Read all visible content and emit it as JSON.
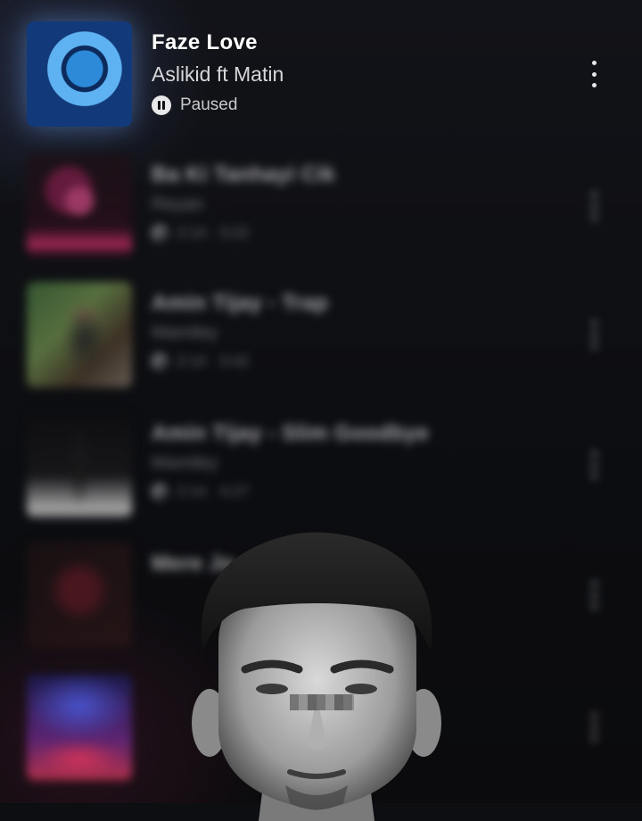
{
  "now_playing": {
    "title": "Faze Love",
    "artist": "Aslikid ft Matin",
    "status": "Paused",
    "icons": {
      "status": "pause-circle-icon",
      "menu": "more-vertical-icon"
    }
  },
  "playlist_blurred": [
    {
      "title": "Ba Ki Tanhayi Cik",
      "artist": "Reyan",
      "meta": "2:14  ·  3:22"
    },
    {
      "title": "Amin Tijay - Trap",
      "artist": "Mamiley",
      "meta": "2:14  ·  3:42"
    },
    {
      "title": "Amin Tijay - Slim Goodbye",
      "artist": "Mamiley",
      "meta": "2:14  ·  4:27"
    },
    {
      "title": "Mere Jo",
      "artist": "",
      "meta": ""
    },
    {
      "title": "",
      "artist": "",
      "meta": ""
    }
  ],
  "colors": {
    "background": "#0d0e11",
    "accent": "#6fc0ff"
  }
}
